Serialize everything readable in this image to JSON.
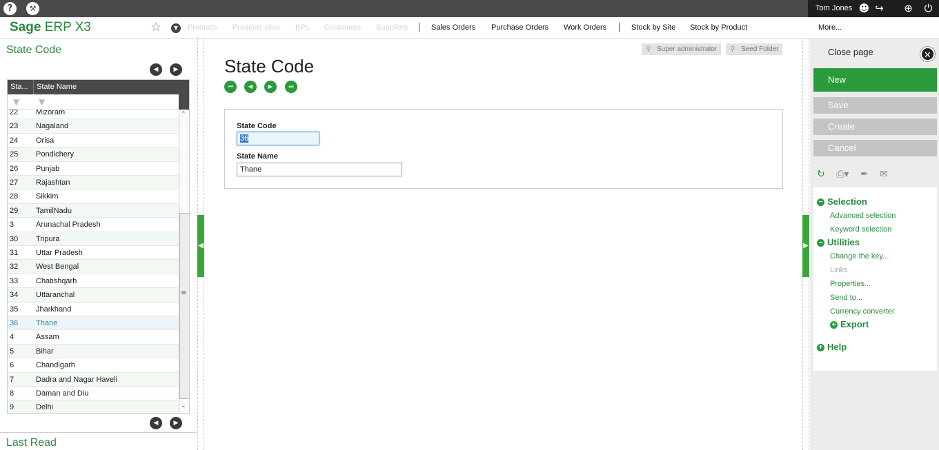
{
  "topbar": {
    "user_name": "Tom Jones"
  },
  "nav": {
    "logo_brand": "Sage",
    "logo_product": " ERP X3",
    "faded_items": [
      "Products",
      "Products sites",
      "BPs",
      "Customers",
      "Suppliers"
    ],
    "items": [
      "Sales Orders",
      "Purchase Orders",
      "Work Orders",
      "Stock by Site",
      "Stock by Product"
    ],
    "more_label": "More..."
  },
  "left": {
    "title": "State Code",
    "col_code": "Sta...",
    "col_name": "State Name",
    "rows": [
      {
        "code": "22",
        "name": "Mizoram"
      },
      {
        "code": "23",
        "name": "Nagaland"
      },
      {
        "code": "24",
        "name": "Orisa"
      },
      {
        "code": "25",
        "name": "Pondichery"
      },
      {
        "code": "26",
        "name": "Punjab"
      },
      {
        "code": "27",
        "name": "Rajashtan"
      },
      {
        "code": "28",
        "name": "Sikkim"
      },
      {
        "code": "29",
        "name": "TamilNadu"
      },
      {
        "code": "3",
        "name": "Arunachal Pradesh"
      },
      {
        "code": "30",
        "name": "Tripura"
      },
      {
        "code": "31",
        "name": "Uttar Pradesh"
      },
      {
        "code": "32",
        "name": "West Bengal"
      },
      {
        "code": "33",
        "name": "Chatishqarh"
      },
      {
        "code": "34",
        "name": "Uttaranchal"
      },
      {
        "code": "35",
        "name": "Jharkhand"
      },
      {
        "code": "36",
        "name": "Thane"
      },
      {
        "code": "4",
        "name": "Assam"
      },
      {
        "code": "5",
        "name": "Bihar"
      },
      {
        "code": "6",
        "name": "Chandigarh"
      },
      {
        "code": "7",
        "name": "Dadra and Nagar Haveli"
      },
      {
        "code": "8",
        "name": "Daman and Diu"
      },
      {
        "code": "9",
        "name": "Delhi"
      }
    ],
    "selected_code": "36",
    "bottom_title": "Last Read"
  },
  "main": {
    "role_user": "Super administrator",
    "role_folder": "Seed Folder",
    "title": "State Code",
    "form": {
      "code_label": "State Code",
      "code_value": "36",
      "name_label": "State Name",
      "name_value": "Thane"
    }
  },
  "right": {
    "close_label": "Close page",
    "btn_new": "New",
    "btn_save": "Save",
    "btn_create": "Create",
    "btn_cancel": "Cancel",
    "sec_selection": "Selection",
    "link_advanced": "Advanced selection",
    "link_keyword": "Keyword selection",
    "sec_utilities": "Utilities",
    "link_change_key": "Change the key...",
    "link_links": "Links",
    "link_properties": "Properties...",
    "link_send": "Send to...",
    "link_currency": "Currency converter",
    "sec_export": "Export",
    "sec_help": "Help"
  },
  "colors": {
    "accent_green": "#2a9a3a",
    "dark_bar": "#4a4a4a",
    "disabled_button": "#c4c4c4"
  }
}
